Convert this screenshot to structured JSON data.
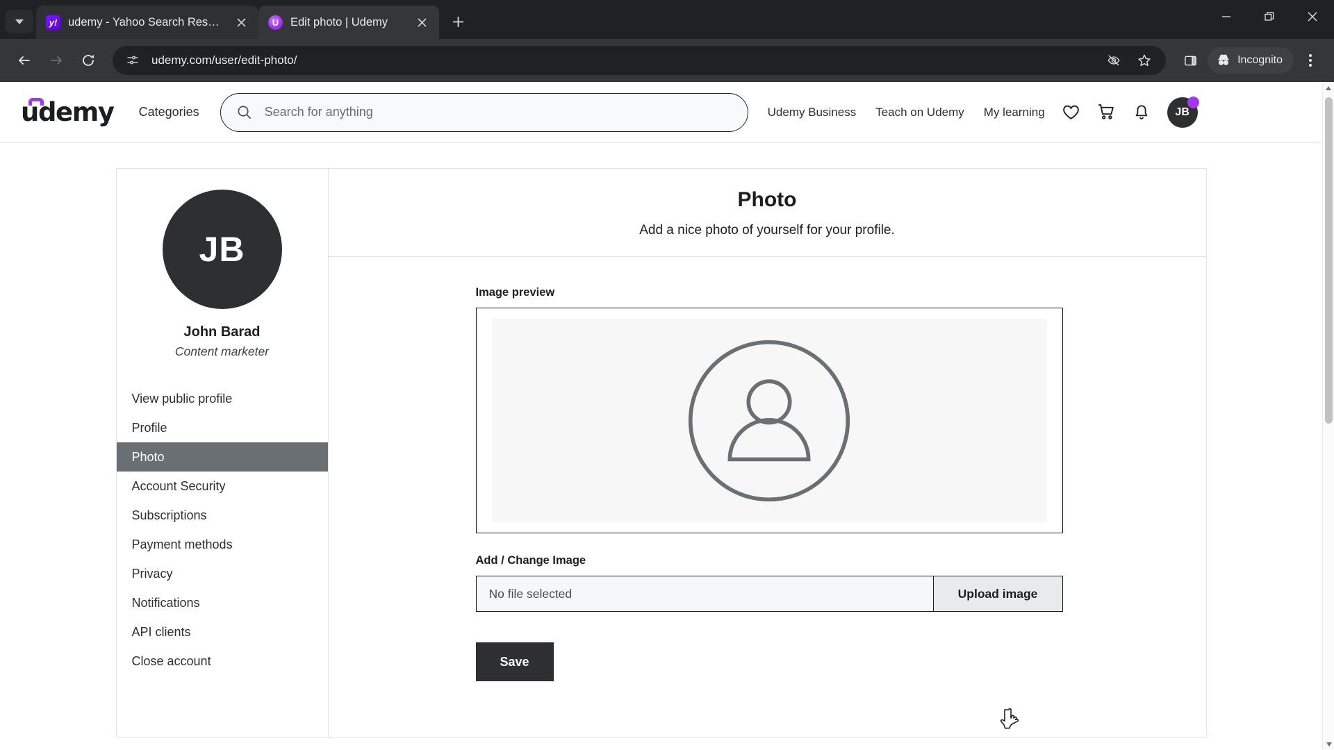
{
  "browser": {
    "tabs": [
      {
        "title": "udemy - Yahoo Search Results",
        "favicon_label": "y!",
        "favicon_name": "yahoo-favicon",
        "active": false
      },
      {
        "title": "Edit photo | Udemy",
        "favicon_label": "U",
        "favicon_name": "udemy-favicon",
        "active": true
      }
    ],
    "url": "udemy.com/user/edit-photo/",
    "profile_label": "Incognito",
    "icons": {
      "tab_search": "chevron-down-icon",
      "new_tab": "plus-icon",
      "back": "back-arrow-icon",
      "forward": "forward-arrow-icon",
      "reload": "reload-icon",
      "site_info": "site-settings-icon",
      "tracking": "eye-off-icon",
      "bookmark": "star-icon",
      "side_panel": "side-panel-icon",
      "incognito": "incognito-hat-icon",
      "menu": "three-dot-menu-icon",
      "minimize": "minimize-icon",
      "maximize": "restore-icon",
      "close": "close-icon"
    }
  },
  "site_header": {
    "logo_text": "udemy",
    "categories_label": "Categories",
    "search_placeholder": "Search for anything",
    "search_value": "",
    "links": [
      "Udemy Business",
      "Teach on Udemy",
      "My learning"
    ],
    "icons": {
      "search": "search-icon",
      "wishlist": "heart-icon",
      "cart": "cart-icon",
      "notifications": "bell-icon"
    },
    "avatar_initials": "JB"
  },
  "sidebar": {
    "avatar_initials": "JB",
    "name": "John Barad",
    "headline": "Content marketer",
    "items": [
      {
        "label": "View public profile",
        "active": false
      },
      {
        "label": "Profile",
        "active": false
      },
      {
        "label": "Photo",
        "active": true
      },
      {
        "label": "Account Security",
        "active": false
      },
      {
        "label": "Subscriptions",
        "active": false
      },
      {
        "label": "Payment methods",
        "active": false
      },
      {
        "label": "Privacy",
        "active": false
      },
      {
        "label": "Notifications",
        "active": false
      },
      {
        "label": "API clients",
        "active": false
      },
      {
        "label": "Close account",
        "active": false
      }
    ]
  },
  "panel": {
    "title": "Photo",
    "subtitle": "Add a nice photo of yourself for your profile.",
    "preview_label": "Image preview",
    "preview_placeholder_icon": "person-placeholder-icon",
    "upload_label": "Add / Change Image",
    "file_status": "No file selected",
    "upload_button": "Upload image",
    "save_button": "Save"
  },
  "colors": {
    "brand_purple": "#a435f0",
    "text_dark": "#1c1d1f",
    "sidebar_active_bg": "#6a6f73",
    "button_dark": "#2d2f31",
    "chrome_dark": "#202124"
  }
}
